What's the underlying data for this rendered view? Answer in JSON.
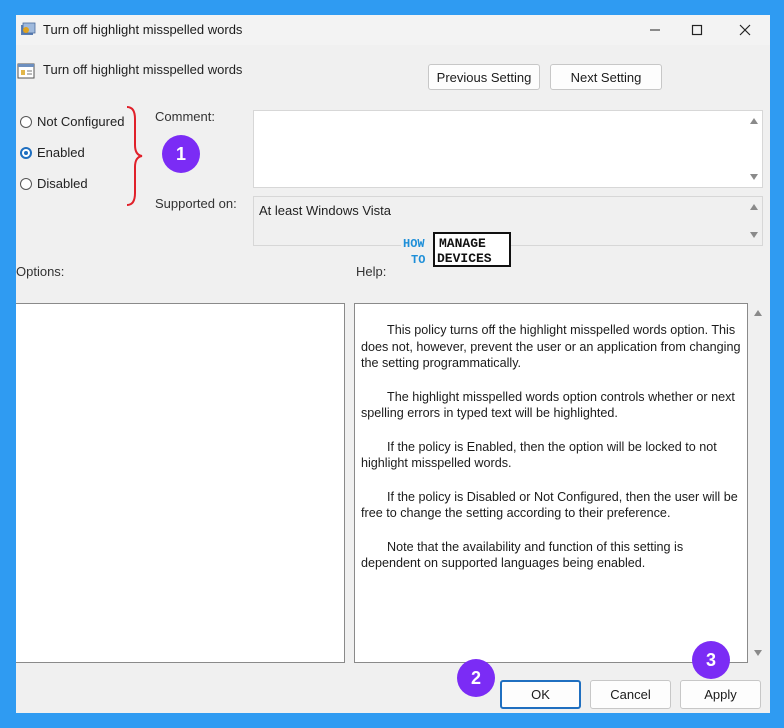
{
  "window": {
    "title": "Turn off highlight misspelled words",
    "controls": {
      "minimize": "minimize-icon",
      "maximize": "maximize-icon",
      "close": "close-icon"
    }
  },
  "header": {
    "setting_name": "Turn off highlight misspelled words",
    "previous_label": "Previous Setting",
    "next_label": "Next Setting"
  },
  "state": {
    "options": [
      {
        "label": "Not Configured",
        "selected": false
      },
      {
        "label": "Enabled",
        "selected": true
      },
      {
        "label": "Disabled",
        "selected": false
      }
    ]
  },
  "comment": {
    "label": "Comment:",
    "value": ""
  },
  "supported": {
    "label": "Supported on:",
    "value": "At least Windows Vista"
  },
  "sections": {
    "options_label": "Options:",
    "help_label": "Help:"
  },
  "help_paragraphs": [
    "This policy turns off the highlight misspelled words option. This does not, however, prevent the user or an application from changing the setting programmatically.",
    "The highlight misspelled words option controls whether or next spelling errors in typed text will be highlighted.",
    "If the policy is Enabled, then the option will be locked to not highlight misspelled words.",
    "If the policy is Disabled or Not Configured, then the user will be free to change the setting according to their preference.",
    "Note that the availability and function of this setting is dependent on supported languages being enabled."
  ],
  "footer": {
    "ok_label": "OK",
    "cancel_label": "Cancel",
    "apply_label": "Apply"
  },
  "annotations": {
    "step1": "1",
    "step2": "2",
    "step3": "3"
  },
  "watermark": {
    "line1a": "HOW",
    "line1b": "MANAGE",
    "line2a": "TO",
    "line2b": "DEVICES"
  },
  "colors": {
    "accent": "#1f6fc0",
    "badge": "#7b2cf5",
    "brace": "#e0202a",
    "frame": "#2f9bf2"
  }
}
